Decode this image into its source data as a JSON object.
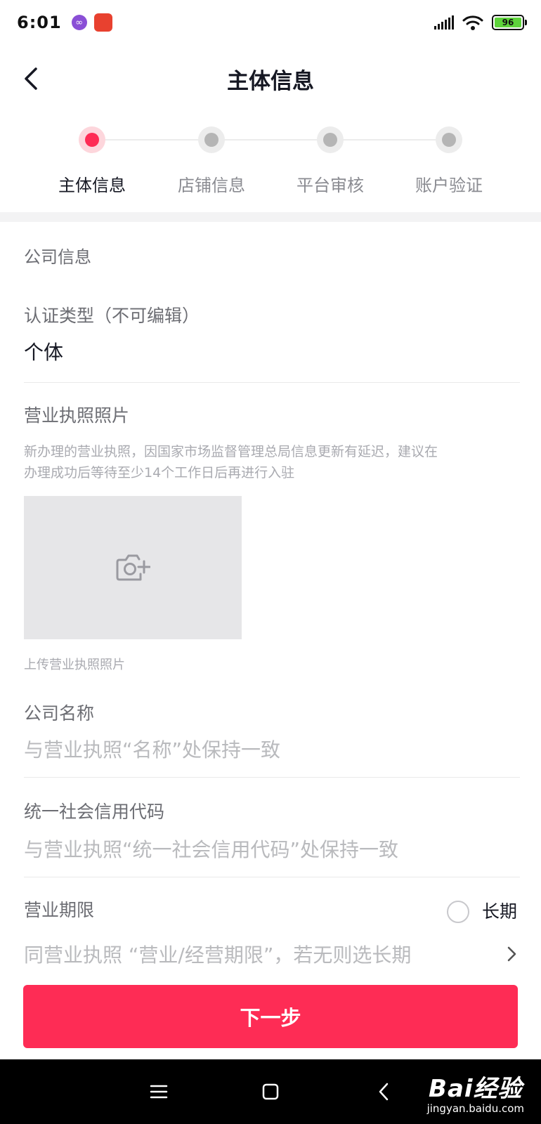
{
  "status_bar": {
    "time": "6:01",
    "battery": "96"
  },
  "header": {
    "title": "主体信息"
  },
  "stepper": {
    "steps": [
      {
        "label": "主体信息",
        "state": "active"
      },
      {
        "label": "店铺信息",
        "state": "inactive"
      },
      {
        "label": "平台审核",
        "state": "inactive"
      },
      {
        "label": "账户验证",
        "state": "inactive"
      }
    ]
  },
  "form": {
    "section_title": "公司信息",
    "cert_type": {
      "label": "认证类型（不可编辑）",
      "value": "个体"
    },
    "license_photo": {
      "label": "营业执照照片",
      "hint_line1": "新办理的营业执照，因国家市场监督管理总局信息更新有延迟，建议在",
      "hint_line2": "办理成功后等待至少14个工作日后再进行入驻",
      "upload_caption": "上传营业执照照片"
    },
    "company_name": {
      "label": "公司名称",
      "placeholder": "与营业执照“名称”处保持一致"
    },
    "credit_code": {
      "label": "统一社会信用代码",
      "placeholder": "与营业执照“统一社会信用代码”处保持一致"
    },
    "business_term": {
      "label": "营业期限",
      "long_term_label": "长期",
      "long_term_checked": false,
      "placeholder": "同营业执照 “营业/经营期限”，若无则选长期"
    }
  },
  "actions": {
    "next_label": "下一步"
  },
  "watermark": {
    "logo": "Bai经验",
    "url": "jingyan.baidu.com"
  },
  "colors": {
    "accent": "#fe2c55",
    "accent_light": "#fdd6dc",
    "inactive_dot": "#b5b5b5",
    "text_primary": "#161823",
    "text_secondary": "#6c6d73",
    "placeholder": "#b9babd"
  },
  "icons": {
    "back": "chevron-left-icon",
    "camera": "camera-plus-icon",
    "forward": "chevron-right-icon",
    "nav_menu": "menu-icon",
    "nav_home": "square-icon",
    "nav_back": "back-triangle-icon"
  }
}
